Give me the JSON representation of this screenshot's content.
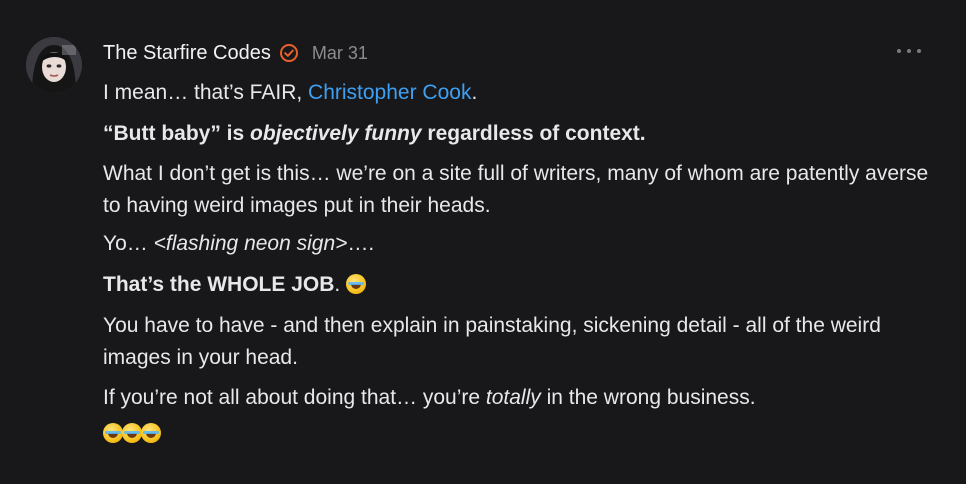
{
  "comment": {
    "author": "The Starfire Codes",
    "date": "Mar 31",
    "verified_icon": "verified-badge-icon",
    "more_icon": "ellipsis-icon",
    "colors": {
      "accent": "#e8612a",
      "mention": "#3ea0f2",
      "background": "#18181a"
    },
    "p1": {
      "before": "I mean… that’s FAIR, ",
      "mention": "Christopher Cook",
      "after": "."
    },
    "p2": {
      "q": "“Butt baby” is ",
      "em": "objectively funny",
      "rest": " regardless of context."
    },
    "p3": "What I don’t get is this… we’re on a site full of writers, many of whom are patently averse to having weird images put in their heads.",
    "p4": {
      "before": "Yo… ",
      "em": "<flashing neon sign>",
      "after": "…."
    },
    "p5": {
      "text": "That’s the WHOLE JOB",
      "after": ". ",
      "emoji": "rolling-on-floor-laughing-emoji"
    },
    "p6": "You have to have - and then explain in painstaking, sickening detail - all of the weird images in your head.",
    "p7": {
      "before": "If you’re not all about doing that… you’re ",
      "em": "totally",
      "after": " in the wrong business."
    },
    "p8": {
      "emoji": "rolling-on-floor-laughing-emoji",
      "count": 3
    }
  }
}
